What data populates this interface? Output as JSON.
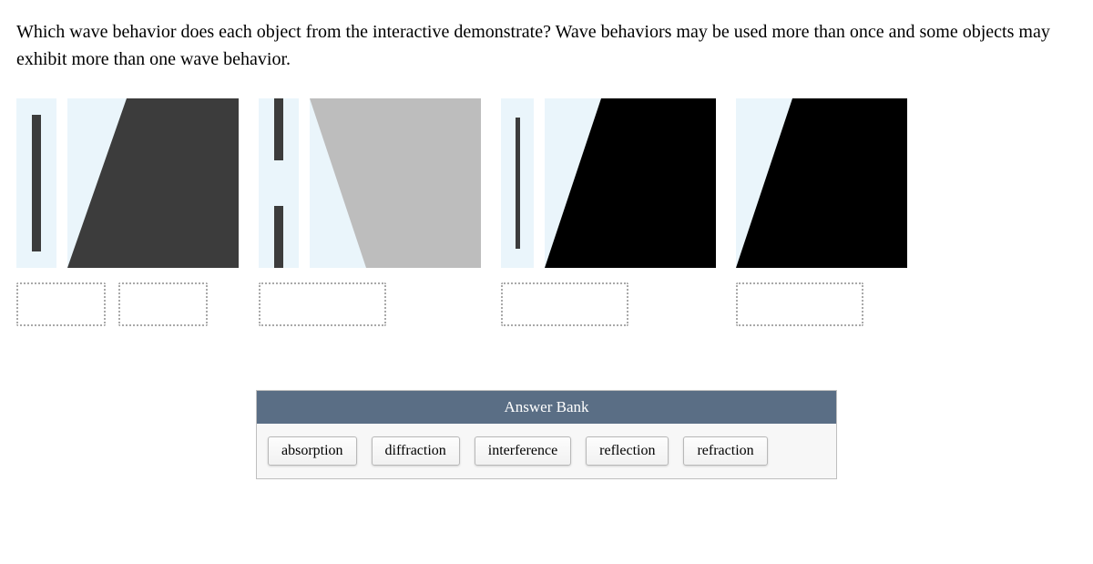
{
  "question": "Which wave behavior does each object from the interactive demonstrate? Wave behaviors may be used more than once and some objects may exhibit more than one wave behavior.",
  "answer_bank": {
    "title": "Answer Bank",
    "options": [
      "absorption",
      "diffraction",
      "interference",
      "reflection",
      "refraction"
    ]
  },
  "shapes": {
    "wedge_dark": "#3c3c3c",
    "wedge_gray": "#bdbdbd",
    "wedge_black": "#000000"
  }
}
